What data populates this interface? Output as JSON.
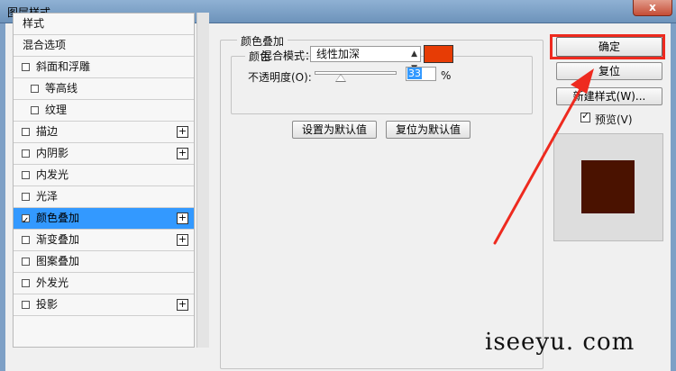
{
  "window": {
    "title": "图层样式",
    "close_label": "x"
  },
  "style_list": {
    "items": [
      {
        "label": "样式",
        "has_checkbox": false,
        "checked": false,
        "has_plus": false,
        "indent": 0
      },
      {
        "label": "混合选项",
        "has_checkbox": false,
        "checked": false,
        "has_plus": false,
        "indent": 0
      },
      {
        "label": "斜面和浮雕",
        "has_checkbox": true,
        "checked": false,
        "has_plus": false,
        "indent": 0
      },
      {
        "label": "等高线",
        "has_checkbox": true,
        "checked": false,
        "has_plus": false,
        "indent": 1
      },
      {
        "label": "纹理",
        "has_checkbox": true,
        "checked": false,
        "has_plus": false,
        "indent": 1
      },
      {
        "label": "描边",
        "has_checkbox": true,
        "checked": false,
        "has_plus": true,
        "indent": 0
      },
      {
        "label": "内阴影",
        "has_checkbox": true,
        "checked": false,
        "has_plus": true,
        "indent": 0
      },
      {
        "label": "内发光",
        "has_checkbox": true,
        "checked": false,
        "has_plus": false,
        "indent": 0
      },
      {
        "label": "光泽",
        "has_checkbox": true,
        "checked": false,
        "has_plus": false,
        "indent": 0
      },
      {
        "label": "颜色叠加",
        "has_checkbox": true,
        "checked": true,
        "has_plus": true,
        "indent": 0,
        "selected": true
      },
      {
        "label": "渐变叠加",
        "has_checkbox": true,
        "checked": false,
        "has_plus": true,
        "indent": 0
      },
      {
        "label": "图案叠加",
        "has_checkbox": true,
        "checked": false,
        "has_plus": false,
        "indent": 0
      },
      {
        "label": "外发光",
        "has_checkbox": true,
        "checked": false,
        "has_plus": false,
        "indent": 0
      },
      {
        "label": "投影",
        "has_checkbox": true,
        "checked": false,
        "has_plus": true,
        "indent": 0
      }
    ]
  },
  "panel": {
    "section_title": "颜色叠加",
    "group_title": "颜色",
    "blend_mode_label": "混合模式：",
    "blend_mode_value": "线性加深",
    "overlay_color": "#e73c05",
    "opacity_label": "不透明度(O):",
    "opacity_value": "33",
    "opacity_unit": "%",
    "opacity_percent": 33,
    "set_default_label": "设置为默认值",
    "reset_default_label": "复位为默认值"
  },
  "actions": {
    "ok_label": "确定",
    "reset_label": "复位",
    "new_style_label": "新建样式(W)...",
    "preview_label": "预览(V)",
    "preview_checked": true,
    "preview_color": "#4a1200"
  },
  "annotation": {
    "highlight_color": "#ee2a1f"
  },
  "watermark": "iseeyu. com"
}
